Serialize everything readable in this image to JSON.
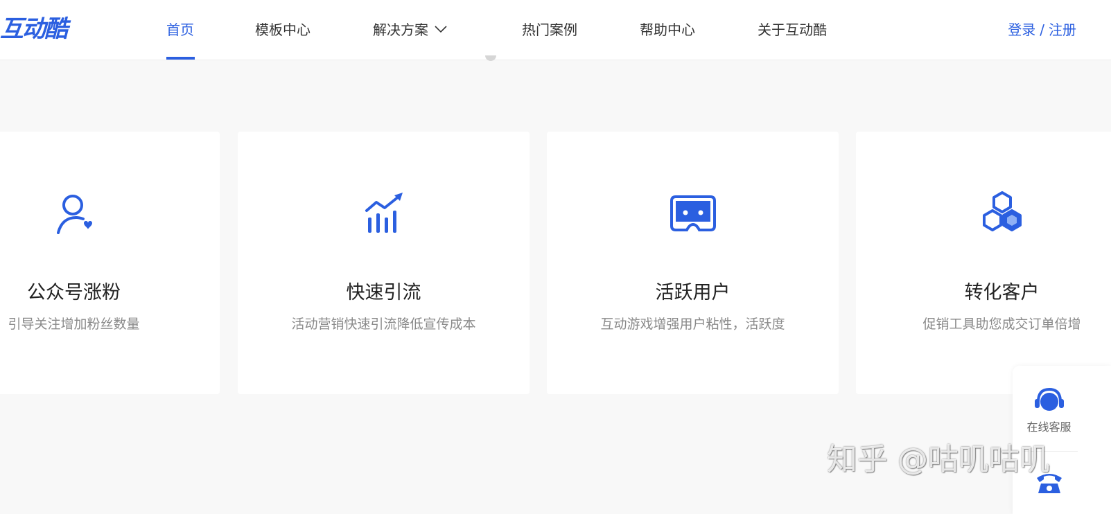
{
  "brand": {
    "logo_text": "互动酷",
    "accent_color": "#2b5fe0"
  },
  "nav": {
    "items": [
      {
        "label": "首页",
        "active": true
      },
      {
        "label": "模板中心"
      },
      {
        "label": "解决方案",
        "has_dropdown": true
      },
      {
        "label": "热门案例"
      },
      {
        "label": "帮助中心"
      },
      {
        "label": "关于互动酷"
      }
    ],
    "login": "登录",
    "separator": "/",
    "register": "注册"
  },
  "cards": [
    {
      "icon": "user-heart-icon",
      "title": "公众号涨粉",
      "desc": "引导关注增加粉丝数量"
    },
    {
      "icon": "growth-chart-icon",
      "title": "快速引流",
      "desc": "活动营销快速引流降低宣传成本"
    },
    {
      "icon": "game-card-icon",
      "title": "活跃用户",
      "desc": "互动游戏增强用户粘性，活跃度"
    },
    {
      "icon": "hexagons-icon",
      "title": "转化客户",
      "desc": "促销工具助您成交订单倍增"
    }
  ],
  "service": {
    "online_label": "在线客服",
    "online_icon": "headset-icon",
    "phone_icon": "phone-icon"
  },
  "watermark": "知乎 @咕叽咕叽"
}
